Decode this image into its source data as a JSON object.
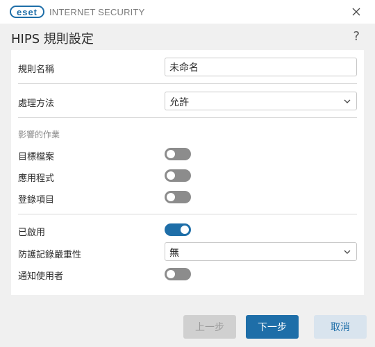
{
  "titlebar": {
    "logo_text": "eset",
    "product_name": "INTERNET SECURITY"
  },
  "header": {
    "title": "HIPS 規則設定",
    "help_label": "?"
  },
  "form": {
    "rule_name_label": "規則名稱",
    "rule_name_value": "未命名",
    "action_label": "處理方法",
    "action_value": "允許",
    "affected_section_label": "影響的作業",
    "target_files_label": "目標檔案",
    "target_files_on": false,
    "applications_label": "應用程式",
    "applications_on": false,
    "registry_label": "登錄項目",
    "registry_on": false,
    "enabled_label": "已啟用",
    "enabled_on": true,
    "log_severity_label": "防護記錄嚴重性",
    "log_severity_value": "無",
    "notify_user_label": "通知使用者",
    "notify_user_on": false
  },
  "footer": {
    "back_label": "上一步",
    "next_label": "下一步",
    "cancel_label": "取消"
  },
  "colors": {
    "accent": "#1e6ea8",
    "toggle_off": "#8c8c8c",
    "disabled_button": "#d0d0d0"
  }
}
